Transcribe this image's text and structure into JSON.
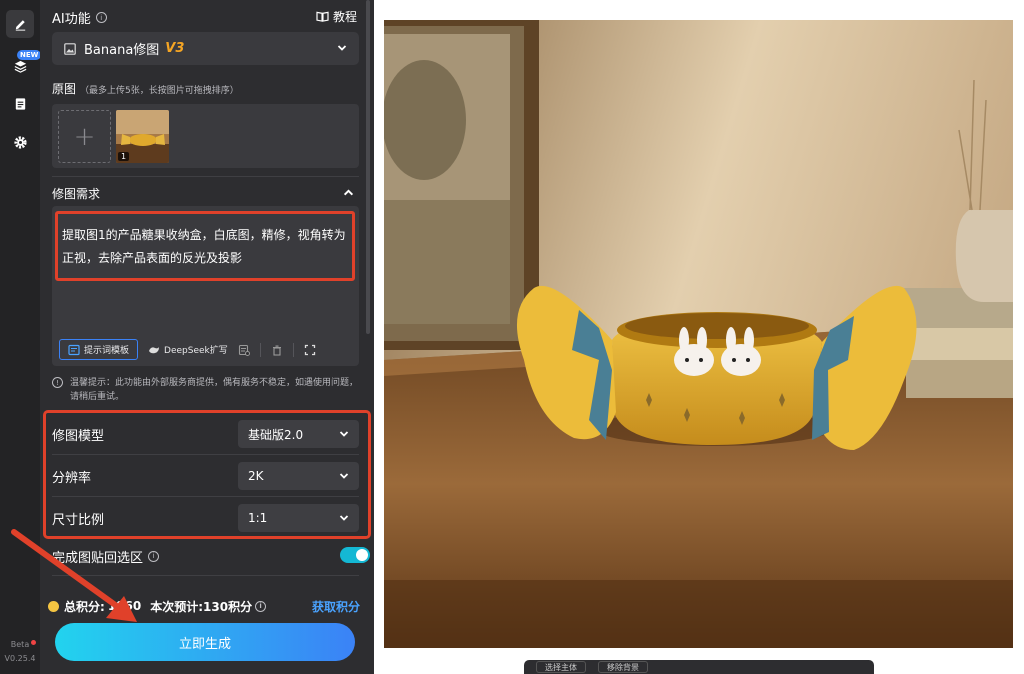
{
  "rail": {
    "new_badge": "NEW",
    "beta_label": "Beta",
    "version": "V0.25.4"
  },
  "header": {
    "title": "AI功能",
    "tutorial_label": "教程"
  },
  "model_select": {
    "name": "Banana修图",
    "version": "V3"
  },
  "original": {
    "label": "原图",
    "hint": "（最多上传5张，长按图片可拖拽排序）",
    "upload_symbol": "+",
    "thumb_index": "1"
  },
  "requirement": {
    "label": "修图需求",
    "text": "提取图1的产品糖果收纳盒，白底图，精修，视角转为正视，去除产品表面的反光及投影",
    "prompt_template_label": "提示词模板",
    "deepseek_label": "DeepSeek扩写"
  },
  "notice": {
    "text": "温馨提示：此功能由外部服务商提供，偶有服务不稳定，如遇使用问题，请稍后重试。"
  },
  "params": [
    {
      "label": "修图模型",
      "value": "基础版2.0"
    },
    {
      "label": "分辨率",
      "value": "2K"
    },
    {
      "label": "尺寸比例",
      "value": "1:1"
    }
  ],
  "toggle": {
    "label": "完成图贴回选区",
    "on": true
  },
  "points": {
    "total_label": "总积分:",
    "total_value": "1860",
    "estimate": "本次预计:130积分",
    "get_label": "获取积分"
  },
  "generate_label": "立即生成",
  "bottom_bar": {
    "select_label": "选择主体",
    "remove_bg_label": "移除背景"
  },
  "colors": {
    "accent_cyan": "#22d3ee",
    "accent_blue": "#3b82f6",
    "highlight_red": "#e0412a",
    "version_orange": "#f5a524"
  }
}
